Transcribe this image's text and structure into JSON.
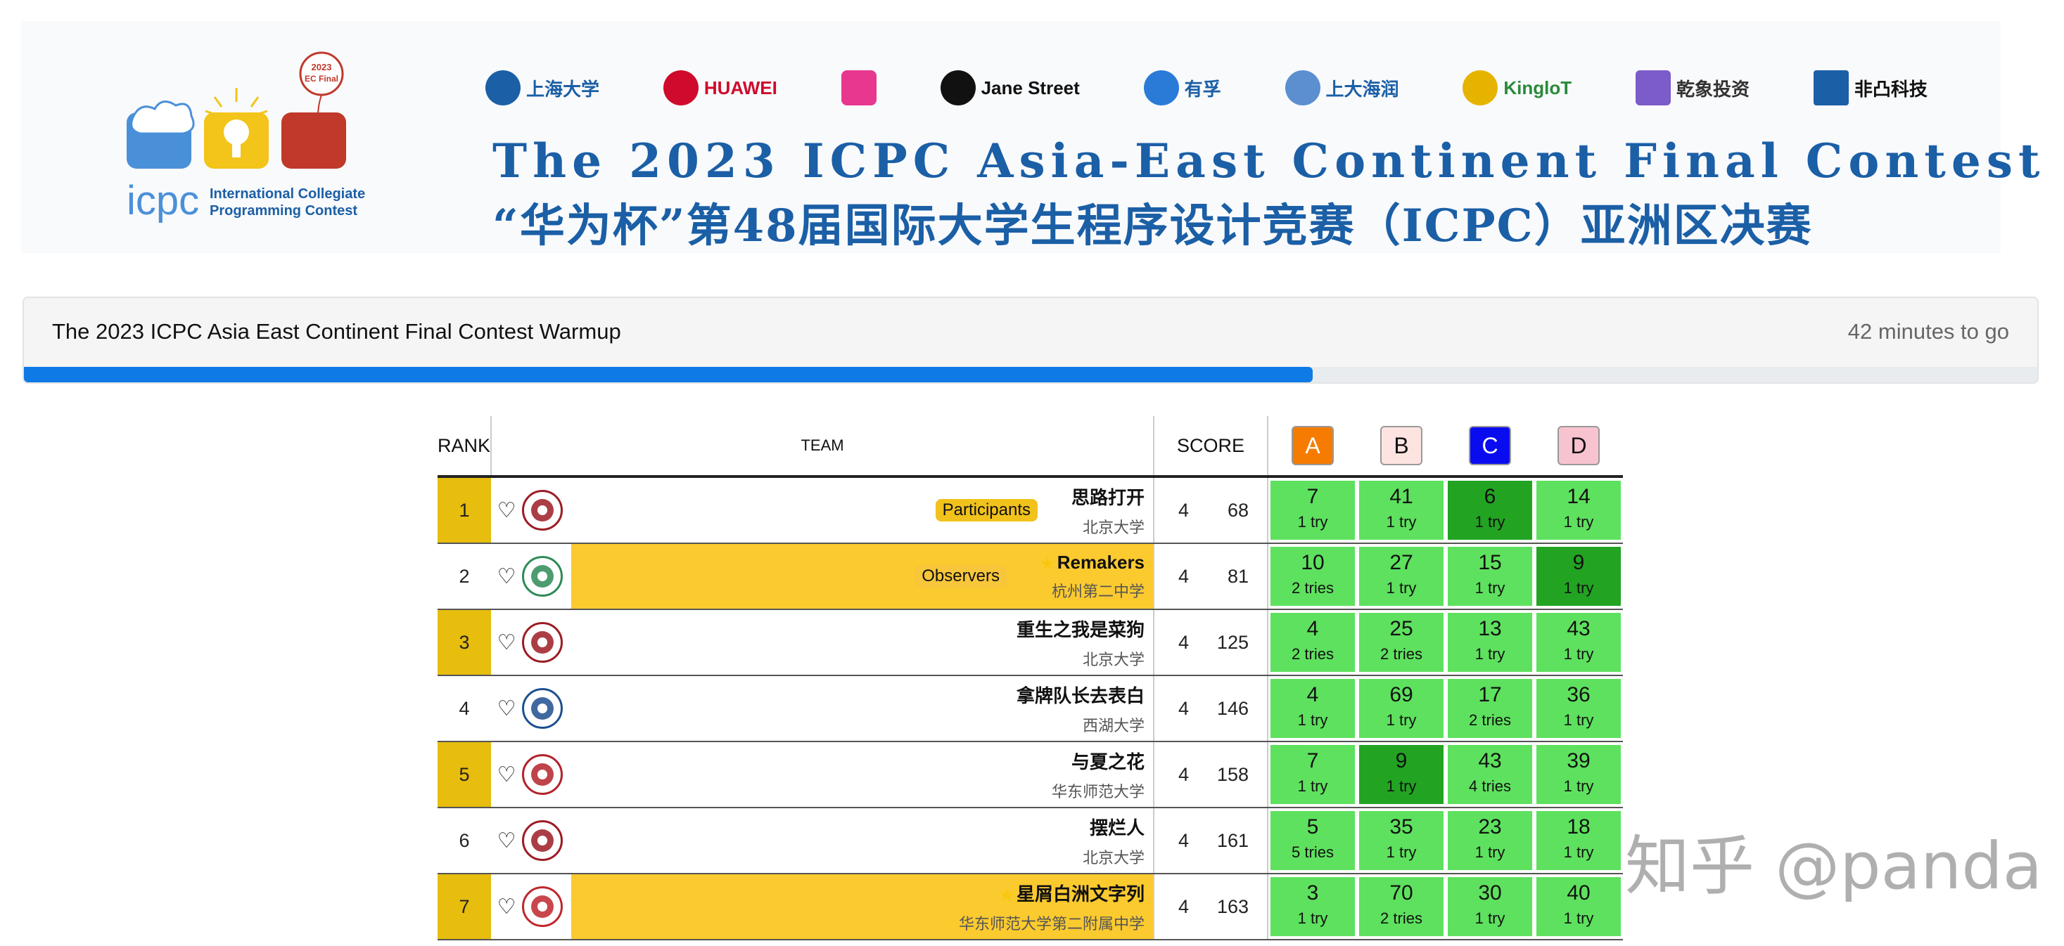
{
  "banner": {
    "sponsors": [
      "上海大学",
      "HUAWEI",
      "",
      "Jane Street",
      "有孚",
      "上大海润",
      "KingloT",
      "乾象投资",
      "非凸科技"
    ],
    "title_en": "The 2023 ICPC Asia-East Continent Final Contest",
    "title_cn": "“华为杯”第48届国际大学生程序设计竞赛（ICPC）亚洲区决赛",
    "logo_balloon": "2023 EC Final",
    "logo_text_1": "International Collegiate",
    "logo_text_2": "Programming Contest",
    "logo_icpc": "icpc"
  },
  "contest": {
    "name": "The 2023 ICPC Asia East Continent Final Contest Warmup",
    "time_left": "42 minutes to go",
    "progress": 0.64
  },
  "table": {
    "headers": {
      "rank": "RANK",
      "team": "TEAM",
      "score": "SCORE"
    },
    "problems": [
      {
        "label": "A",
        "color": "#f57c00",
        "text_color": "#ffffff"
      },
      {
        "label": "B",
        "color": "#fde4e1",
        "text_color": "#111111"
      },
      {
        "label": "C",
        "color": "#0a0cf0",
        "text_color": "#ffffff"
      },
      {
        "label": "D",
        "color": "#f7c3cf",
        "text_color": "#111111"
      }
    ],
    "rows": [
      {
        "rank": "1",
        "name": "思路打开",
        "school": "北京大学",
        "tag": "Participants",
        "observer": false,
        "star": false,
        "solved": "4",
        "penalty": "68",
        "cells": [
          {
            "t": "7",
            "tries": "1 try",
            "first": false
          },
          {
            "t": "41",
            "tries": "1 try",
            "first": false
          },
          {
            "t": "6",
            "tries": "1 try",
            "first": true
          },
          {
            "t": "14",
            "tries": "1 try",
            "first": false
          }
        ]
      },
      {
        "rank": "2",
        "name": "Remakers",
        "school": "杭州第二中学",
        "tag": "Observers",
        "observer": true,
        "star": true,
        "solved": "4",
        "penalty": "81",
        "cells": [
          {
            "t": "10",
            "tries": "2 tries",
            "first": false
          },
          {
            "t": "27",
            "tries": "1 try",
            "first": false
          },
          {
            "t": "15",
            "tries": "1 try",
            "first": false
          },
          {
            "t": "9",
            "tries": "1 try",
            "first": true
          }
        ]
      },
      {
        "rank": "3",
        "name": "重生之我是菜狗",
        "school": "北京大学",
        "tag": "",
        "observer": false,
        "star": false,
        "solved": "4",
        "penalty": "125",
        "cells": [
          {
            "t": "4",
            "tries": "2 tries",
            "first": false
          },
          {
            "t": "25",
            "tries": "2 tries",
            "first": false
          },
          {
            "t": "13",
            "tries": "1 try",
            "first": false
          },
          {
            "t": "43",
            "tries": "1 try",
            "first": false
          }
        ]
      },
      {
        "rank": "4",
        "name": "拿牌队长去表白",
        "school": "西湖大学",
        "tag": "",
        "observer": false,
        "star": false,
        "solved": "4",
        "penalty": "146",
        "cells": [
          {
            "t": "4",
            "tries": "1 try",
            "first": false
          },
          {
            "t": "69",
            "tries": "1 try",
            "first": false
          },
          {
            "t": "17",
            "tries": "2 tries",
            "first": false
          },
          {
            "t": "36",
            "tries": "1 try",
            "first": false
          }
        ]
      },
      {
        "rank": "5",
        "name": "与夏之花",
        "school": "华东师范大学",
        "tag": "",
        "observer": false,
        "star": false,
        "solved": "4",
        "penalty": "158",
        "cells": [
          {
            "t": "7",
            "tries": "1 try",
            "first": false
          },
          {
            "t": "9",
            "tries": "1 try",
            "first": true
          },
          {
            "t": "43",
            "tries": "4 tries",
            "first": false
          },
          {
            "t": "39",
            "tries": "1 try",
            "first": false
          }
        ]
      },
      {
        "rank": "6",
        "name": "摆烂人",
        "school": "北京大学",
        "tag": "",
        "observer": false,
        "star": false,
        "solved": "4",
        "penalty": "161",
        "cells": [
          {
            "t": "5",
            "tries": "5 tries",
            "first": false
          },
          {
            "t": "35",
            "tries": "1 try",
            "first": false
          },
          {
            "t": "23",
            "tries": "1 try",
            "first": false
          },
          {
            "t": "18",
            "tries": "1 try",
            "first": false
          }
        ]
      },
      {
        "rank": "7",
        "name": "星屑白洲文字列",
        "school": "华东师范大学第二附属中学",
        "tag": "",
        "observer": true,
        "star": true,
        "solved": "4",
        "penalty": "163",
        "cells": [
          {
            "t": "3",
            "tries": "1 try",
            "first": false
          },
          {
            "t": "70",
            "tries": "2 tries",
            "first": false
          },
          {
            "t": "30",
            "tries": "1 try",
            "first": false
          },
          {
            "t": "40",
            "tries": "1 try",
            "first": false
          }
        ]
      }
    ]
  },
  "watermark": "知乎 @panda"
}
